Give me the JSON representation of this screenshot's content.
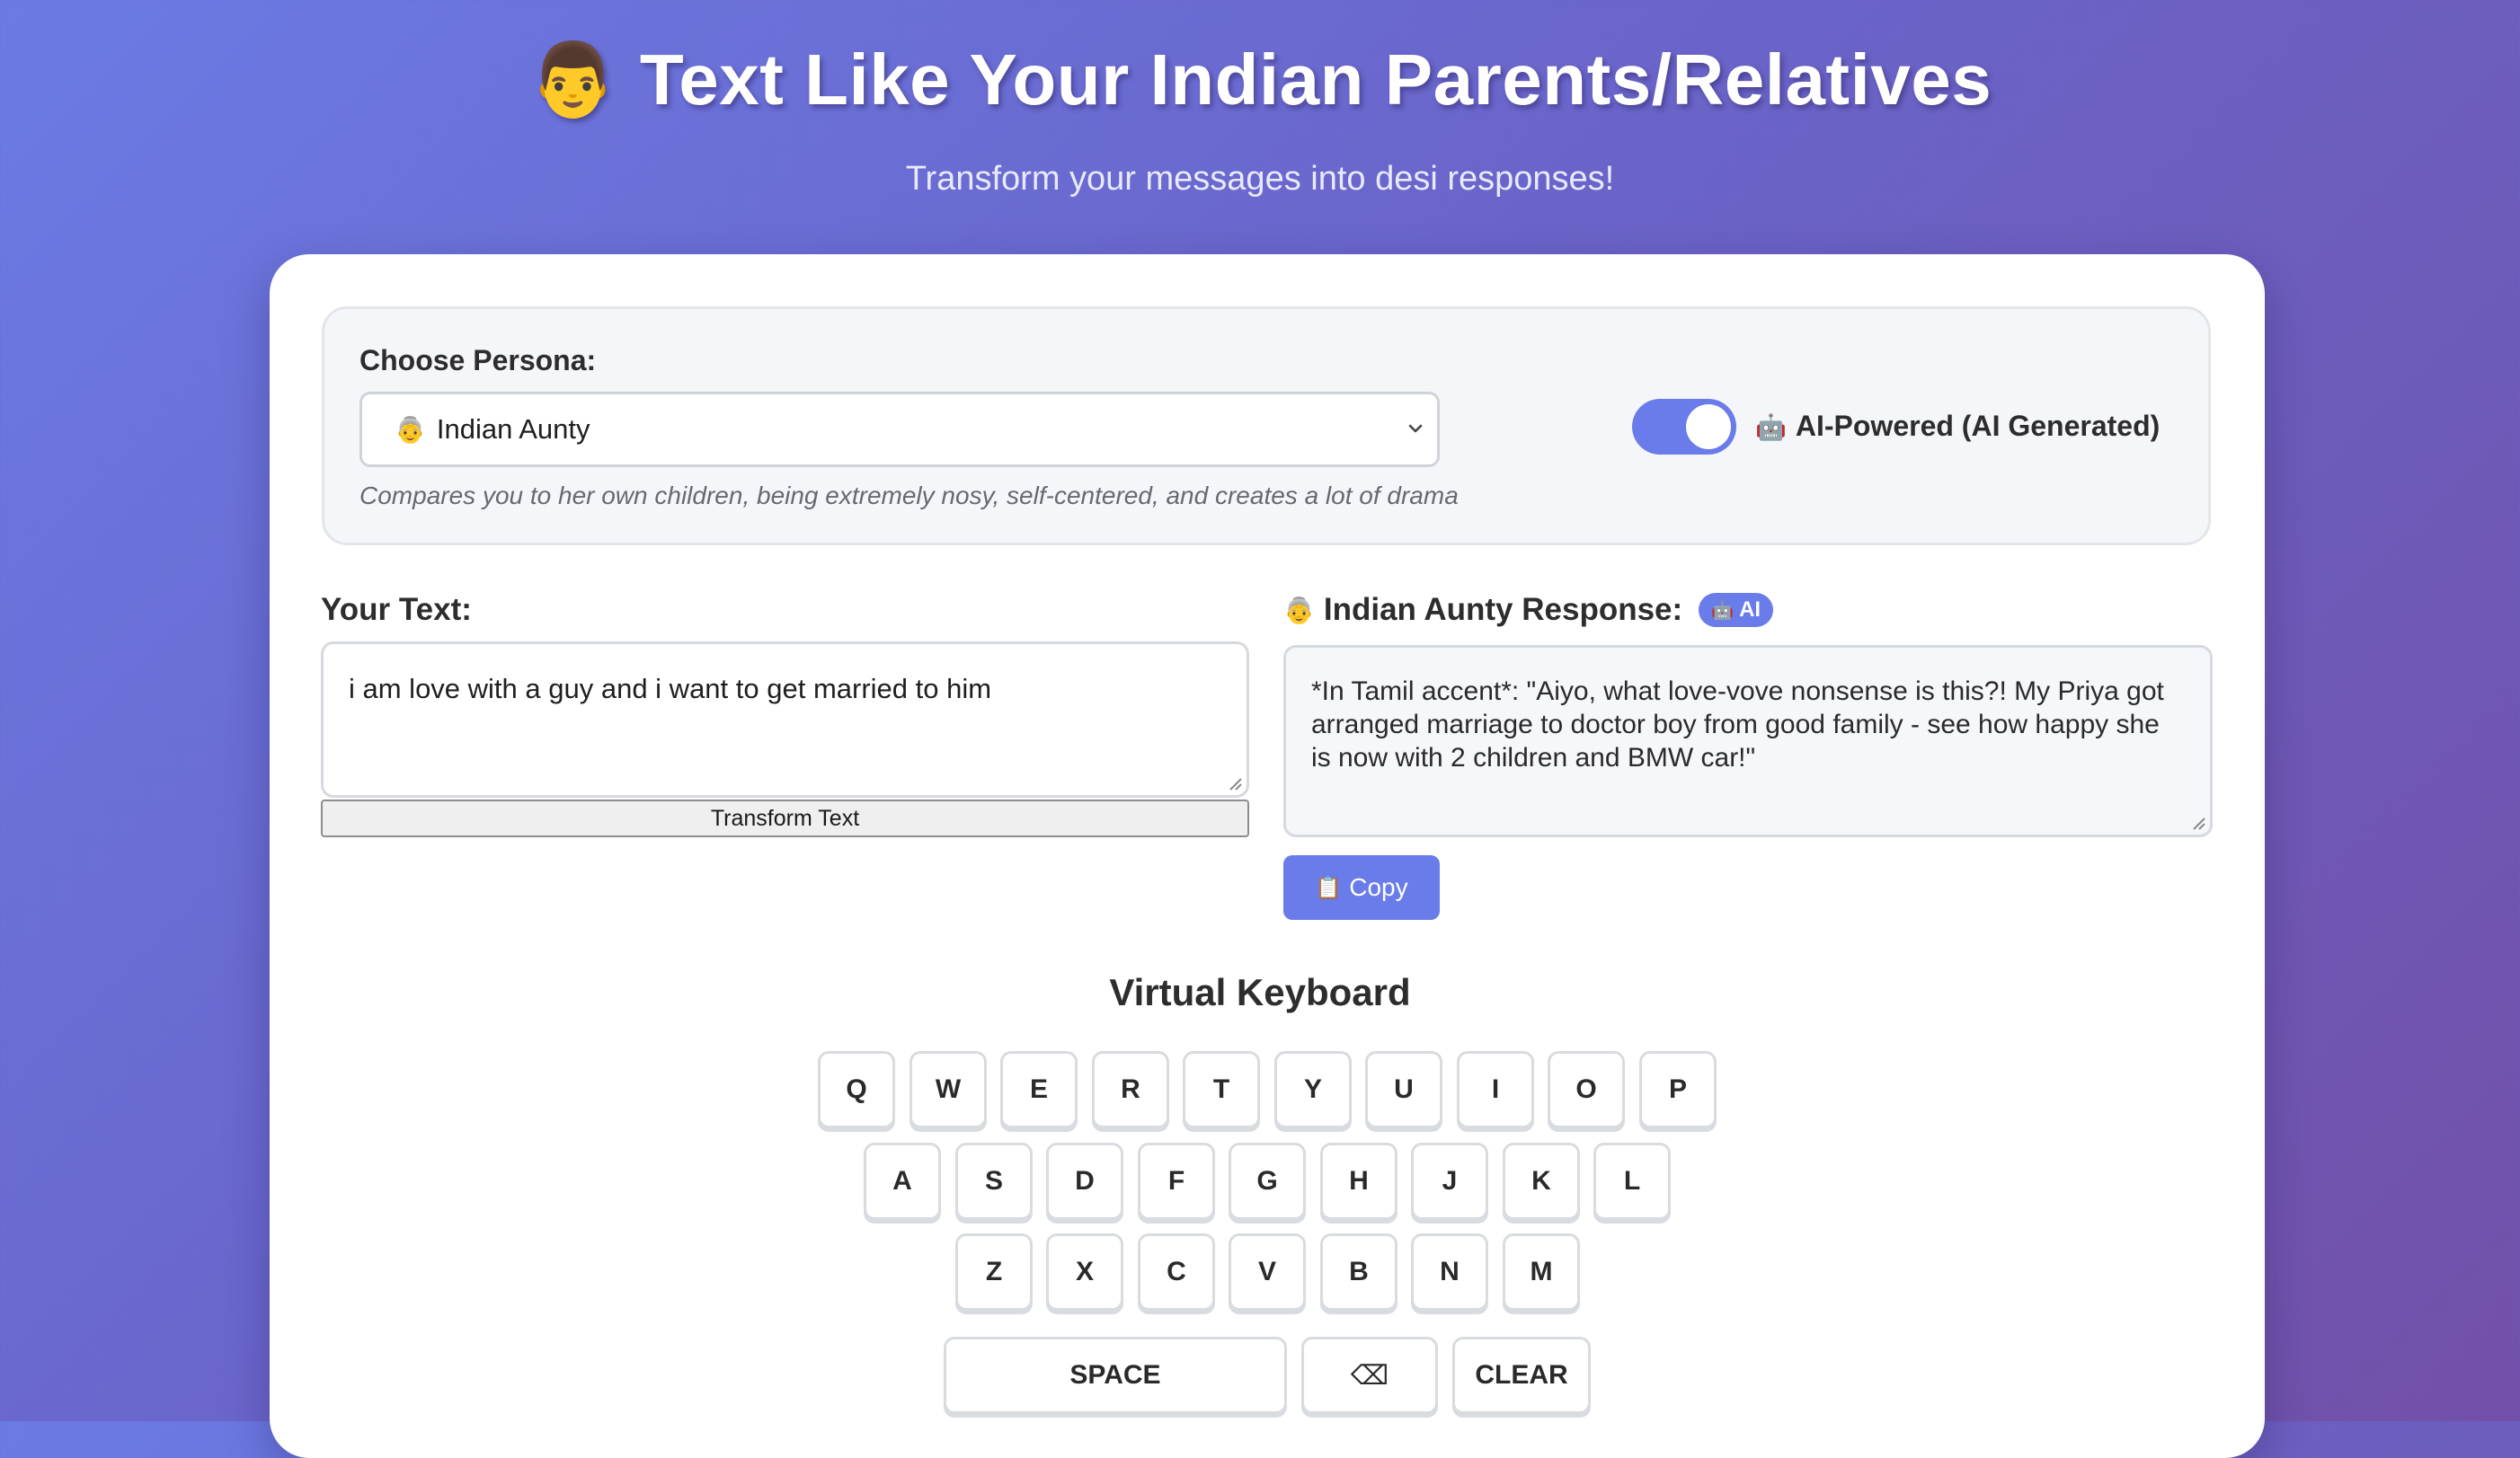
{
  "header": {
    "emoji": "👨",
    "title": "Text Like Your Indian Parents/Relatives",
    "subtitle": "Transform your messages into desi responses!"
  },
  "persona": {
    "label": "Choose Persona:",
    "selected_emoji": "👵",
    "selected": "Indian Aunty",
    "description": "Compares you to her own children, being extremely nosy, self-centered, and creates a lot of drama"
  },
  "ai_toggle": {
    "on": true,
    "emoji": "🤖",
    "label": "AI-Powered (AI Generated)"
  },
  "input": {
    "label": "Your Text:",
    "value": "i am love with a guy and i want to get married to him",
    "transform_button": "Transform Text"
  },
  "response": {
    "emoji": "👵",
    "label": "Indian Aunty Response:",
    "badge_emoji": "🤖",
    "badge": "AI",
    "text": "*In Tamil accent*: \"Aiyo, what love-vove nonsense is this?! My Priya got arranged marriage to doctor boy from good family - see how happy she is now with 2 children and BMW car!\"",
    "copy_emoji": "📋",
    "copy_label": "Copy"
  },
  "keyboard": {
    "title": "Virtual Keyboard",
    "row1": [
      "Q",
      "W",
      "E",
      "R",
      "T",
      "Y",
      "U",
      "I",
      "O",
      "P"
    ],
    "row2": [
      "A",
      "S",
      "D",
      "F",
      "G",
      "H",
      "J",
      "K",
      "L"
    ],
    "row3": [
      "Z",
      "X",
      "C",
      "V",
      "B",
      "N",
      "M"
    ],
    "space": "SPACE",
    "backspace": "⌫",
    "clear": "CLEAR"
  },
  "colors": {
    "accent": "#6a7bea",
    "gradient_start": "#6b7be4",
    "gradient_end": "#7250a8"
  }
}
